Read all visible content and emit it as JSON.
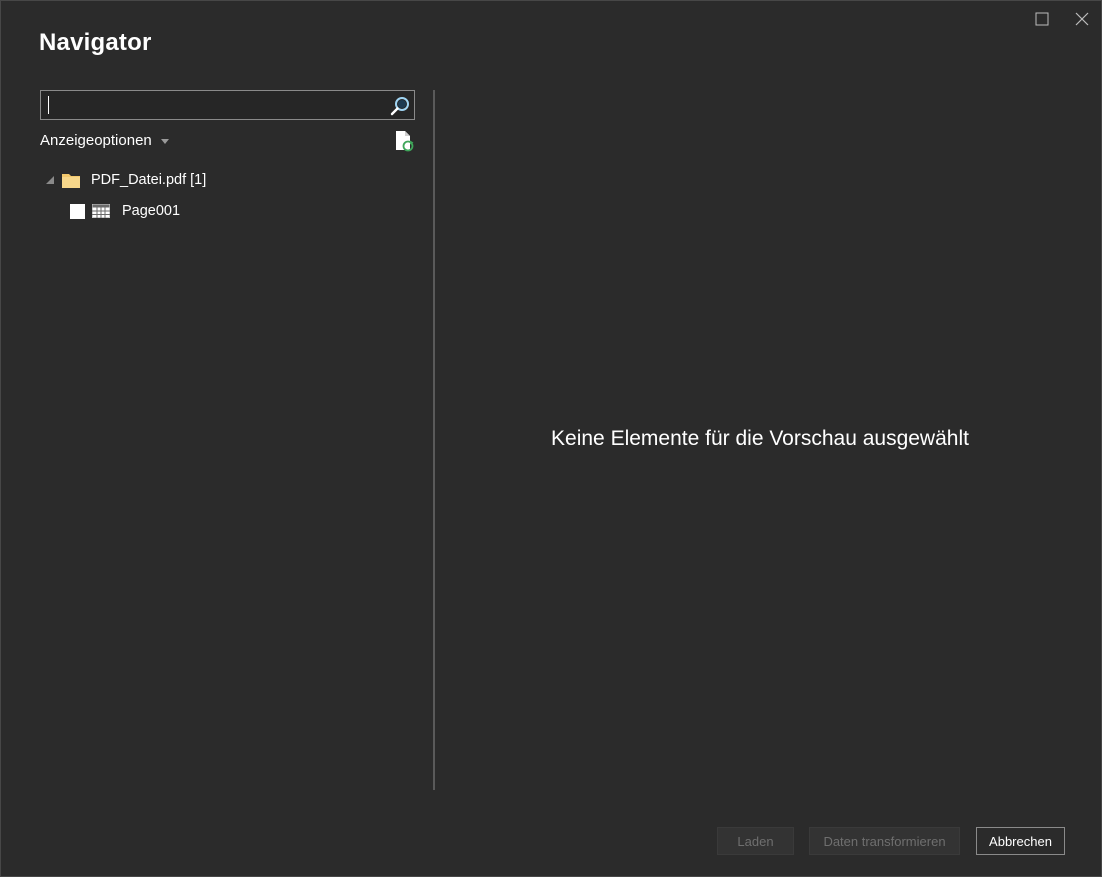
{
  "dialog": {
    "title": "Navigator"
  },
  "window_controls": {
    "maximize_icon": "maximize-icon",
    "close_icon": "close-icon"
  },
  "search": {
    "value": "",
    "placeholder": "",
    "icon": "search-icon"
  },
  "display_options": {
    "label": "Anzeigeoptionen",
    "icon": "chevron-down-icon"
  },
  "refresh": {
    "icon": "refresh-file-icon"
  },
  "tree": {
    "root": {
      "label": "PDF_Datei.pdf [1]",
      "icon": "folder-icon",
      "expanded": true
    },
    "children": [
      {
        "label": "Page001",
        "icon": "table-icon",
        "checked": false
      }
    ]
  },
  "preview": {
    "empty_message": "Keine Elemente für die Vorschau ausgewählt"
  },
  "buttons": {
    "load": "Laden",
    "transform": "Daten transformieren",
    "cancel": "Abbrechen"
  },
  "colors": {
    "background": "#2b2b2b",
    "folder": "#f3c86c",
    "text": "#ffffff"
  }
}
